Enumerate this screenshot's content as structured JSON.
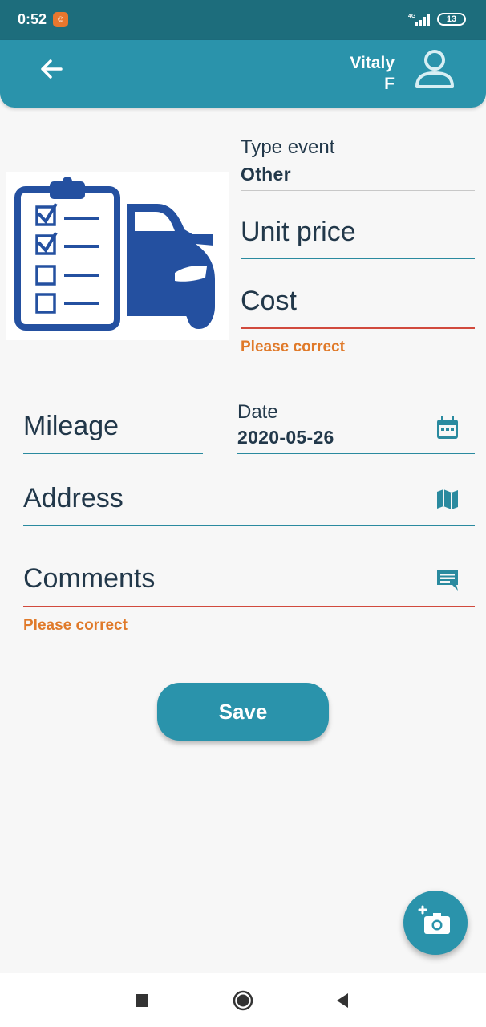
{
  "status_bar": {
    "time": "0:52",
    "notification_icon": "app-notification-icon",
    "network": "4G",
    "battery": "13"
  },
  "app_bar": {
    "back_icon": "arrow-back-icon",
    "user_first": "Vitaly",
    "user_last": "F",
    "user_icon": "account-icon"
  },
  "illustration": {
    "icon": "checklist-car-illustration",
    "color": "#2450a0"
  },
  "form": {
    "type_event": {
      "label": "Type event",
      "value": "Other"
    },
    "unit_price": {
      "placeholder": "Unit price"
    },
    "cost": {
      "placeholder": "Cost",
      "error": "Please correct"
    },
    "mileage": {
      "placeholder": "Mileage"
    },
    "date": {
      "label": "Date",
      "value": "2020-05-26",
      "icon": "calendar-icon"
    },
    "address": {
      "placeholder": "Address",
      "icon": "map-icon"
    },
    "comments": {
      "placeholder": "Comments",
      "error": "Please correct",
      "icon": "comment-icon"
    }
  },
  "save_label": "Save",
  "fab_icon": "add-photo-icon",
  "colors": {
    "primary": "#2a93ab",
    "status_bar": "#1d6d7c",
    "error_line": "#d14a3d",
    "error_text": "#e07a2a"
  },
  "nav": [
    "recents-button",
    "home-button",
    "back-button"
  ]
}
